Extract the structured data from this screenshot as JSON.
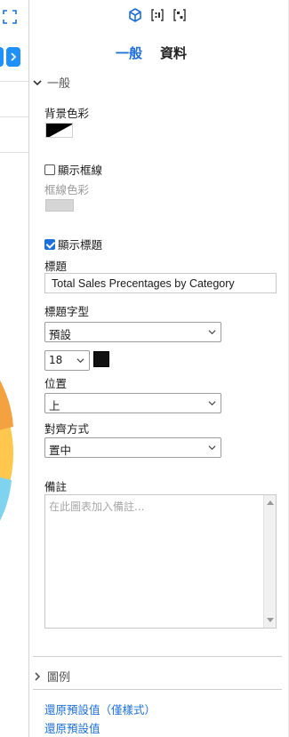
{
  "header": {
    "tabs": [
      {
        "label": "一般",
        "active": true
      },
      {
        "label": "資料",
        "active": false
      }
    ],
    "icons": [
      "cube-icon",
      "bracket-select-icon",
      "bracket-split-icon"
    ]
  },
  "general_section": {
    "title": "一般",
    "background_color_label": "背景色彩",
    "show_border": {
      "label": "顯示框線",
      "checked": false
    },
    "border_color_label": "框線色彩",
    "show_title": {
      "label": "顯示標題",
      "checked": true
    },
    "title_label": "標題",
    "title_value": "Total Sales Precentages by Category",
    "title_font_label": "標題字型",
    "title_font_value": "預設",
    "font_size_value": "18",
    "title_color": "#111111",
    "position_label": "位置",
    "position_value": "上",
    "alignment_label": "對齊方式",
    "alignment_value": "置中",
    "notes_label": "備註",
    "notes_placeholder": "在此圖表加入備註..."
  },
  "legend_section": {
    "title": "圖例"
  },
  "footer_links": {
    "restore_style": "還原預設值（僅樣式）",
    "restore_all": "還原預設值"
  },
  "colors": {
    "accent": "#1e6fd9",
    "nav_button": "#1e90ff"
  }
}
